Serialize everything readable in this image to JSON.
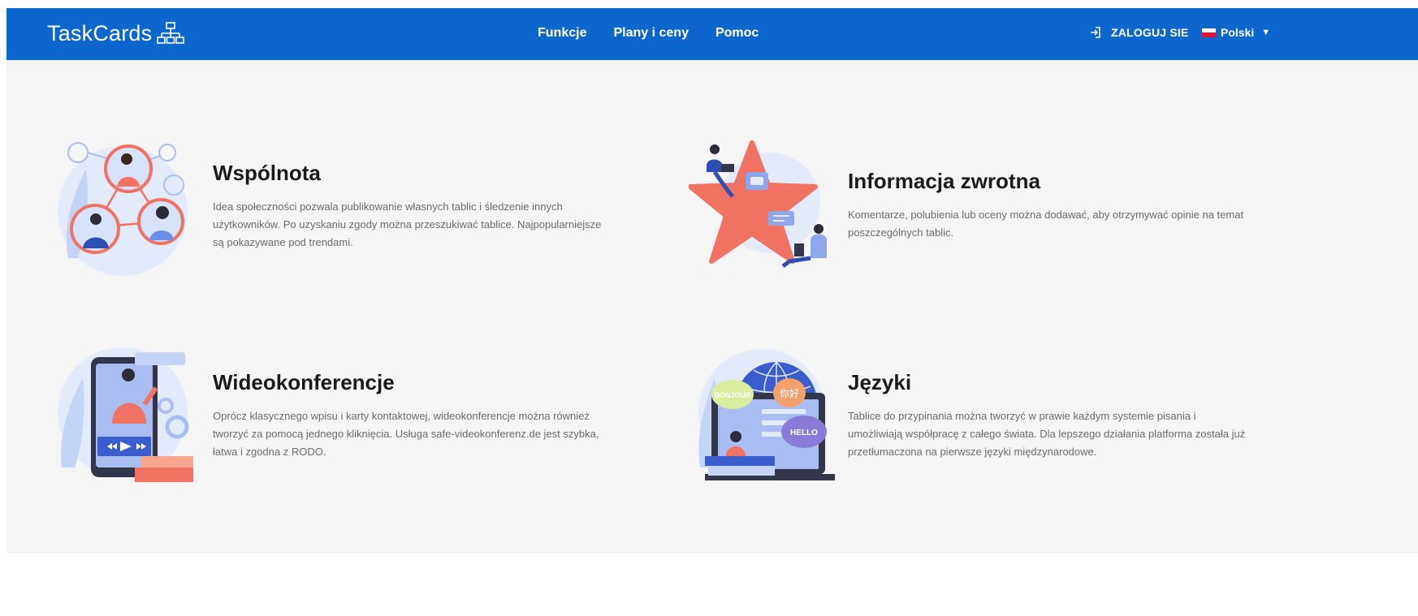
{
  "navbar": {
    "brand": "TaskCards",
    "links": [
      "Funkcje",
      "Plany i ceny",
      "Pomoc"
    ],
    "login_label": "ZALOGUJ SIE",
    "language": "Polski",
    "colors": {
      "bar": "#0d66cc",
      "text": "#ffffff"
    }
  },
  "features": [
    {
      "title": "Wspólnota",
      "lines": [
        "Idea społeczności pozwala publikowanie własnych tablic i śledzenie innych",
        "użytkowników. Po uzyskaniu zgody można przeszukiwać tablice. Najpopularniejsze",
        "są pokazywane pod trendami."
      ],
      "illustration": "community-network-illustration"
    },
    {
      "title": "Informacja zwrotna",
      "lines": [
        "Komentarze, polubienia lub oceny można dodawać, aby otrzymywać opinie na temat",
        "poszczególnych tablic."
      ],
      "illustration": "feedback-star-illustration"
    },
    {
      "title": "Wideokonferencje",
      "lines": [
        "Oprócz klasycznego wpisu i karty kontaktowej, wideokonferencje można również",
        "tworzyć za pomocą jednego kliknięcia. Usługa safe-videokonferenz.de jest szybka,",
        "łatwa i zgodna z RODO."
      ],
      "illustration": "video-conference-illustration"
    },
    {
      "title": "Języki",
      "lines": [
        "Tablice do przypinania można tworzyć w prawie każdym systemie pisania i",
        "umożliwiają współpracę z całego świata. Dla lepszego działania platforma została już",
        "przetłumaczona na pierwsze języki międzynarodowe."
      ],
      "illustration": "languages-globe-illustration",
      "bubbles": [
        "BONJOUR",
        "你好",
        "HELLO"
      ]
    }
  ]
}
